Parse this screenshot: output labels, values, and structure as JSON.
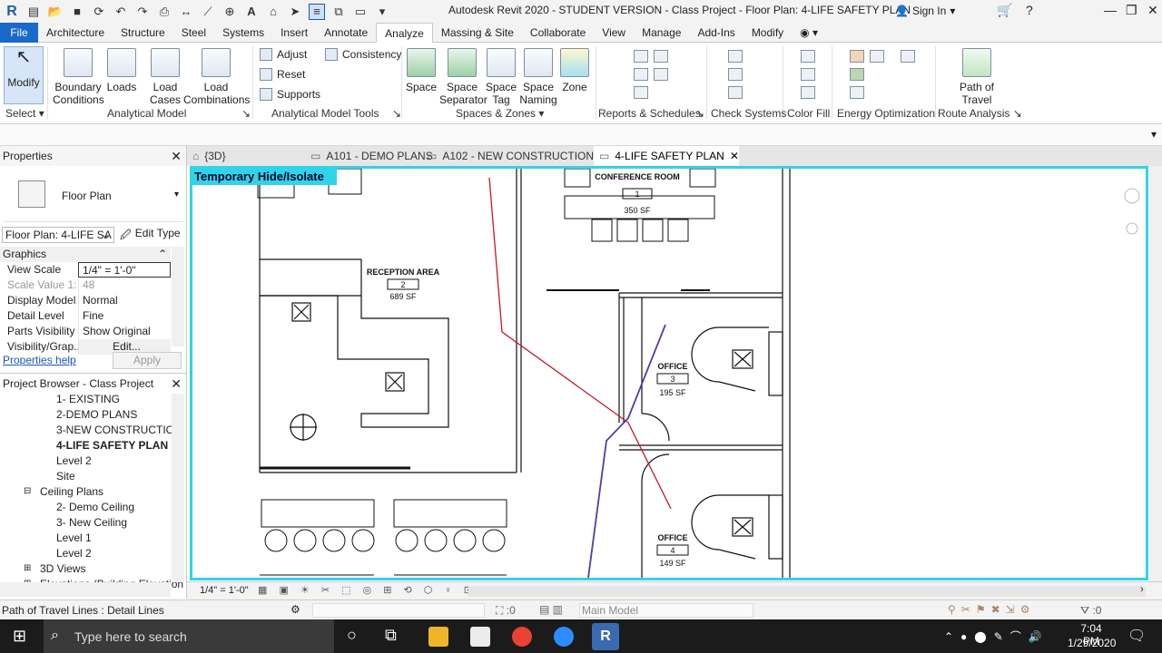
{
  "titlebar": {
    "title": "Autodesk Revit 2020 - STUDENT VERSION - Class Project - Floor Plan: 4-LIFE SAFETY PLAN",
    "signin": "Sign In"
  },
  "ribbon_tabs": [
    "File",
    "Architecture",
    "Structure",
    "Steel",
    "Systems",
    "Insert",
    "Annotate",
    "Analyze",
    "Massing & Site",
    "Collaborate",
    "View",
    "Manage",
    "Add-Ins",
    "Modify"
  ],
  "active_tab": "Analyze",
  "ribbon": {
    "modify": "Modify",
    "boundary": "Boundary\nConditions",
    "loads": "Loads",
    "load_cases": "Load\nCases",
    "load_combinations": "Load\nCombinations",
    "adjust": "Adjust",
    "consistency": "Consistency",
    "reset": "Reset",
    "supports": "Supports",
    "space": "Space",
    "space_separator": "Space\nSeparator",
    "space_tag": "Space\nTag",
    "space_naming": "Space\nNaming",
    "zone": "Zone",
    "path_of_travel": "Path of\nTravel",
    "panels": {
      "select": "Select",
      "analytical_model": "Analytical Model",
      "analytical_model_tools": "Analytical Model Tools",
      "spaces_zones": "Spaces & Zones",
      "reports": "Reports & Schedules",
      "check_systems": "Check Systems",
      "color_fill": "Color Fill",
      "energy": "Energy Optimization",
      "route": "Route Analysis"
    }
  },
  "properties": {
    "title": "Properties",
    "type": "Floor Plan",
    "selector": "Floor Plan: 4-LIFE SA",
    "edit_type": "Edit Type",
    "group": "Graphics",
    "rows": [
      {
        "k": "View Scale",
        "v": "1/4\" = 1'-0\""
      },
      {
        "k": "Scale Value    1:",
        "v": "48"
      },
      {
        "k": "Display Model",
        "v": "Normal"
      },
      {
        "k": "Detail Level",
        "v": "Fine"
      },
      {
        "k": "Parts Visibility",
        "v": "Show Original"
      },
      {
        "k": "Visibility/Grap...",
        "v": "Edit..."
      }
    ],
    "help": "Properties help",
    "apply": "Apply"
  },
  "browser": {
    "title": "Project Browser - Class Project",
    "items": [
      "1- EXISTING",
      "2-DEMO PLANS",
      "3-NEW CONSTRUCTION",
      "4-LIFE SAFETY PLAN",
      "Level 2",
      "Site",
      "Ceiling Plans",
      "2- Demo Ceiling",
      "3- New Ceiling",
      "Level 1",
      "Level 2",
      "3D Views",
      "Elevations (Building Elevation"
    ]
  },
  "view_tabs": [
    "{3D}",
    "A101 - DEMO PLANS",
    "A102 - NEW CONSTRUCTION",
    "4-LIFE SAFETY PLAN"
  ],
  "canvas": {
    "banner": "Temporary Hide/Isolate",
    "rooms": [
      {
        "name": "CONFERENCE ROOM",
        "num": "1",
        "area": "350 SF"
      },
      {
        "name": "RECEPTION AREA",
        "num": "2",
        "area": "689 SF"
      },
      {
        "name": "OFFICE",
        "num": "3",
        "area": "195 SF"
      },
      {
        "name": "OFFICE",
        "num": "4",
        "area": "149 SF"
      }
    ]
  },
  "view_control": {
    "scale": "1/4\" = 1'-0\""
  },
  "status": {
    "message": "Path of Travel Lines : Detail Lines",
    "selection": ":0",
    "model": "Main Model",
    "filter": ":0"
  },
  "taskbar": {
    "search": "Type here to search",
    "time": "7:04 PM",
    "date": "1/29/2020"
  }
}
